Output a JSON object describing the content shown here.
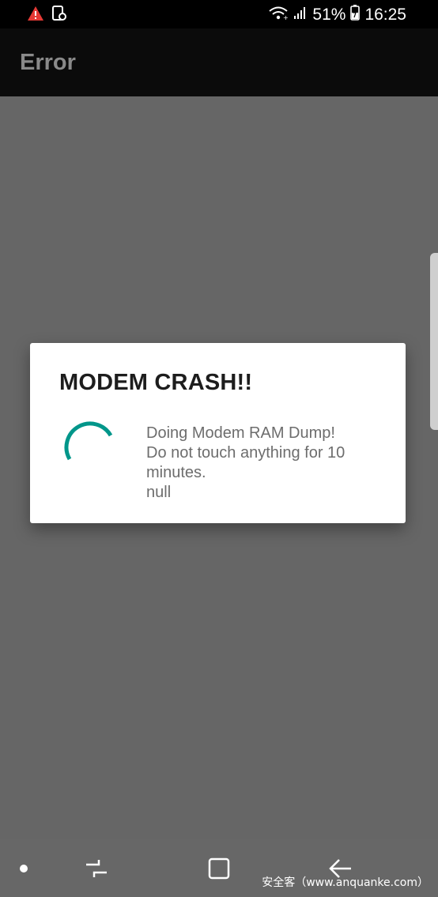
{
  "status_bar": {
    "time": "16:25",
    "battery": "51%",
    "icons": [
      "warning-icon",
      "notification-icon",
      "wifi-icon",
      "signal-icon",
      "battery-icon"
    ]
  },
  "app_bar": {
    "title": "Error"
  },
  "dialog": {
    "title": "MODEM CRASH!!",
    "message": "Doing Modem RAM Dump!\n Do not touch anything for 10\nminutes.\nnull"
  },
  "nav_bar": {
    "icons": [
      "dot-icon",
      "recents-icon",
      "home-icon",
      "back-icon"
    ]
  },
  "watermark": "安全客（www.anquanke.com）",
  "colors": {
    "spinner": "#00968A",
    "warning": "#E53935",
    "background": "#666666"
  }
}
